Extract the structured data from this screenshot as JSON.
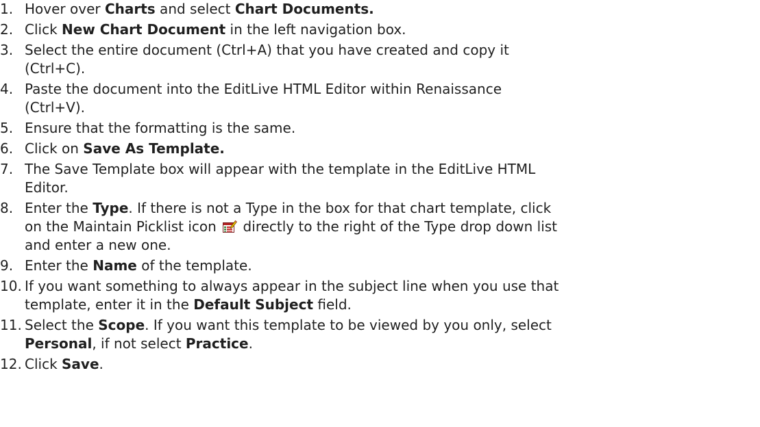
{
  "steps": [
    {
      "num": "1.",
      "parts": [
        {
          "t": "Hover over "
        },
        {
          "t": "Charts",
          "b": true
        },
        {
          "t": " and select "
        },
        {
          "t": "Chart Documents.",
          "b": true
        }
      ]
    },
    {
      "num": "2.",
      "parts": [
        {
          "t": "Click "
        },
        {
          "t": "New Chart Document",
          "b": true
        },
        {
          "t": " in the left navigation box."
        }
      ]
    },
    {
      "num": "3.",
      "parts": [
        {
          "t": "Select the entire document (Ctrl+A) that you have created and copy it"
        },
        {
          "br": true
        },
        {
          "t": "(Ctrl+C)."
        }
      ]
    },
    {
      "num": "4.",
      "parts": [
        {
          "t": "Paste the document into the EditLive HTML Editor within Renaissance"
        },
        {
          "br": true
        },
        {
          "t": "(Ctrl+V)."
        }
      ]
    },
    {
      "num": "5.",
      "parts": [
        {
          "t": "Ensure that the formatting is the same."
        }
      ]
    },
    {
      "num": "6.",
      "parts": [
        {
          "t": "Click on "
        },
        {
          "t": "Save As Template.",
          "b": true
        }
      ]
    },
    {
      "num": "7.",
      "parts": [
        {
          "t": "The Save Template box will appear with the template in the EditLive HTML"
        },
        {
          "br": true
        },
        {
          "t": "Editor."
        }
      ]
    },
    {
      "num": "8.",
      "parts": [
        {
          "t": "Enter the "
        },
        {
          "t": "Type",
          "b": true
        },
        {
          "t": ". If there is not a Type in the box for that chart template, click"
        },
        {
          "br": true
        },
        {
          "t": "on the Maintain Picklist icon "
        },
        {
          "icon": "maintain-picklist-icon"
        },
        {
          "t": " directly to the right of the Type drop down list"
        },
        {
          "br": true
        },
        {
          "t": "and enter a new one."
        }
      ]
    },
    {
      "num": "9.",
      "parts": [
        {
          "t": "Enter the "
        },
        {
          "t": "Name",
          "b": true
        },
        {
          "t": " of the template."
        }
      ]
    },
    {
      "num": "10.",
      "parts": [
        {
          "t": "If you want something to always appear in the subject line when you use that"
        },
        {
          "br": true
        },
        {
          "t": "template, enter it in the "
        },
        {
          "t": "Default Subject",
          "b": true
        },
        {
          "t": " field."
        }
      ]
    },
    {
      "num": "11.",
      "parts": [
        {
          "t": "Select the "
        },
        {
          "t": "Scope",
          "b": true
        },
        {
          "t": ". If you want this template to be viewed by you only, select"
        },
        {
          "br": true
        },
        {
          "t": "Personal",
          "b": true
        },
        {
          "t": ", if not select "
        },
        {
          "t": "Practice",
          "b": true
        },
        {
          "t": "."
        }
      ]
    },
    {
      "num": "12.",
      "parts": [
        {
          "t": "Click "
        },
        {
          "t": "Save",
          "b": true
        },
        {
          "t": "."
        }
      ]
    }
  ]
}
